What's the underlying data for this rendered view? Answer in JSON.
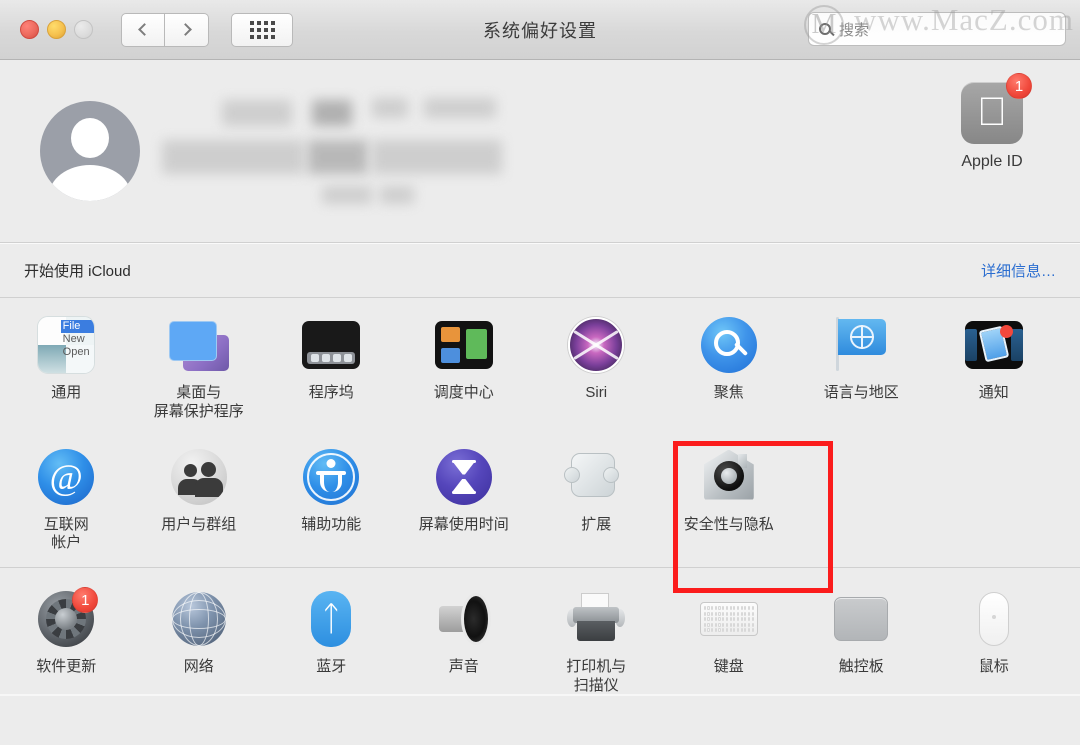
{
  "window": {
    "title": "系统偏好设置",
    "traffic_lights": [
      "close",
      "minimize",
      "zoom"
    ],
    "nav": {
      "back_icon": "chevron-left-icon",
      "forward_icon": "chevron-right-icon"
    },
    "show_all_icon": "grid-icon"
  },
  "search": {
    "placeholder": "搜索",
    "icon": "search-icon"
  },
  "watermark": {
    "text": "www.MacZ.com",
    "logo": "M"
  },
  "account": {
    "avatar_icon": "user-avatar-icon",
    "name_redacted": true,
    "apple_id": {
      "label": "Apple ID",
      "icon": "apple-logo-icon",
      "badge": "1"
    }
  },
  "icloud": {
    "text": "开始使用 iCloud",
    "link": "详细信息…",
    "link_color": "#2a6dd0"
  },
  "panes": {
    "sections": [
      {
        "rows": [
          [
            {
              "label": "通用",
              "icon": "general-icon",
              "badge": null
            },
            {
              "label": "桌面与\n屏幕保护程序",
              "icon": "desktop-screensaver-icon",
              "badge": null
            },
            {
              "label": "程序坞",
              "icon": "dock-icon",
              "badge": null
            },
            {
              "label": "调度中心",
              "icon": "mission-control-icon",
              "badge": null
            },
            {
              "label": "Siri",
              "icon": "siri-icon",
              "badge": null
            },
            {
              "label": "聚焦",
              "icon": "spotlight-icon",
              "badge": null
            },
            {
              "label": "语言与地区",
              "icon": "language-region-icon",
              "badge": null
            },
            {
              "label": "通知",
              "icon": "notifications-icon",
              "badge": null
            }
          ],
          [
            {
              "label": "互联网\n帐户",
              "icon": "internet-accounts-icon",
              "badge": null
            },
            {
              "label": "用户与群组",
              "icon": "users-groups-icon",
              "badge": null
            },
            {
              "label": "辅助功能",
              "icon": "accessibility-icon",
              "badge": null
            },
            {
              "label": "屏幕使用时间",
              "icon": "screen-time-icon",
              "badge": null
            },
            {
              "label": "扩展",
              "icon": "extensions-icon",
              "badge": null
            },
            {
              "label": "安全性与隐私",
              "icon": "security-privacy-icon",
              "badge": null
            },
            {
              "label": "",
              "icon": null,
              "badge": null
            },
            {
              "label": "",
              "icon": null,
              "badge": null
            }
          ]
        ]
      },
      {
        "rows": [
          [
            {
              "label": "软件更新",
              "icon": "software-update-icon",
              "badge": "1"
            },
            {
              "label": "网络",
              "icon": "network-icon",
              "badge": null
            },
            {
              "label": "蓝牙",
              "icon": "bluetooth-icon",
              "badge": null
            },
            {
              "label": "声音",
              "icon": "sound-icon",
              "badge": null
            },
            {
              "label": "打印机与\n扫描仪",
              "icon": "printers-scanners-icon",
              "badge": null
            },
            {
              "label": "键盘",
              "icon": "keyboard-icon",
              "badge": null
            },
            {
              "label": "触控板",
              "icon": "trackpad-icon",
              "badge": null
            },
            {
              "label": "鼠标",
              "icon": "mouse-icon",
              "badge": null
            }
          ]
        ]
      }
    ]
  },
  "highlight": {
    "target": "安全性与隐私",
    "color": "#fb1c1c"
  }
}
